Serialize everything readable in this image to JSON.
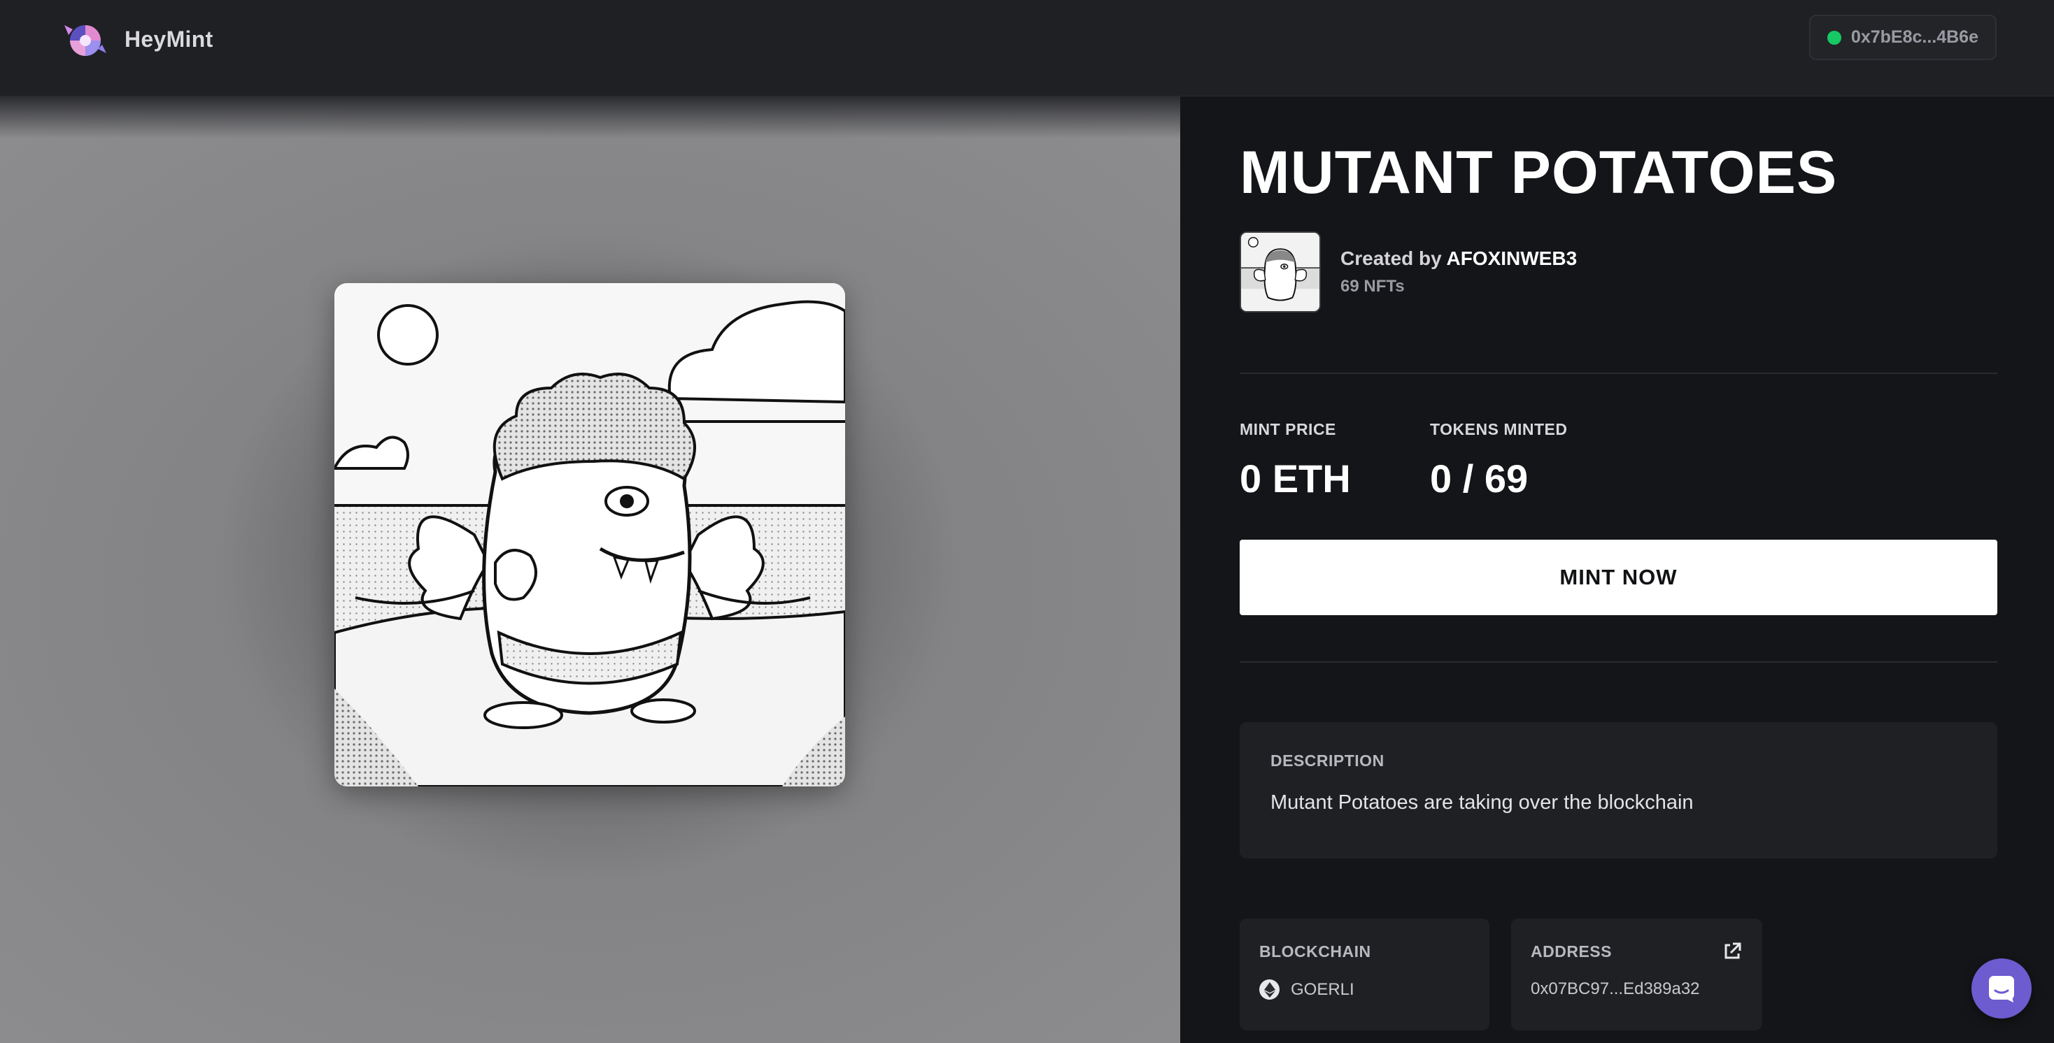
{
  "header": {
    "brand": "HeyMint",
    "wallet_address": "0x7bE8c...4B6e",
    "wallet_status_color": "#17c964"
  },
  "collection": {
    "title": "MUTANT POTATOES",
    "created_by_prefix": "Created by ",
    "creator_name": "AFOXINWEB3",
    "nft_count": "69 NFTs"
  },
  "stats": {
    "mint_price_label": "MINT PRICE",
    "mint_price_value": "0 ETH",
    "tokens_minted_label": "TOKENS MINTED",
    "tokens_minted_value": "0 / 69"
  },
  "mint_button_label": "MINT NOW",
  "description": {
    "label": "DESCRIPTION",
    "text": "Mutant Potatoes are taking over the blockchain"
  },
  "blockchain": {
    "label": "BLOCKCHAIN",
    "value": "GOERLI",
    "icon": "ethereum-icon"
  },
  "address": {
    "label": "ADDRESS",
    "value": "0x07BC97...Ed389a32",
    "icon": "external-link-icon"
  },
  "chat": {
    "icon": "chat-icon",
    "color": "#6d5bd0"
  }
}
